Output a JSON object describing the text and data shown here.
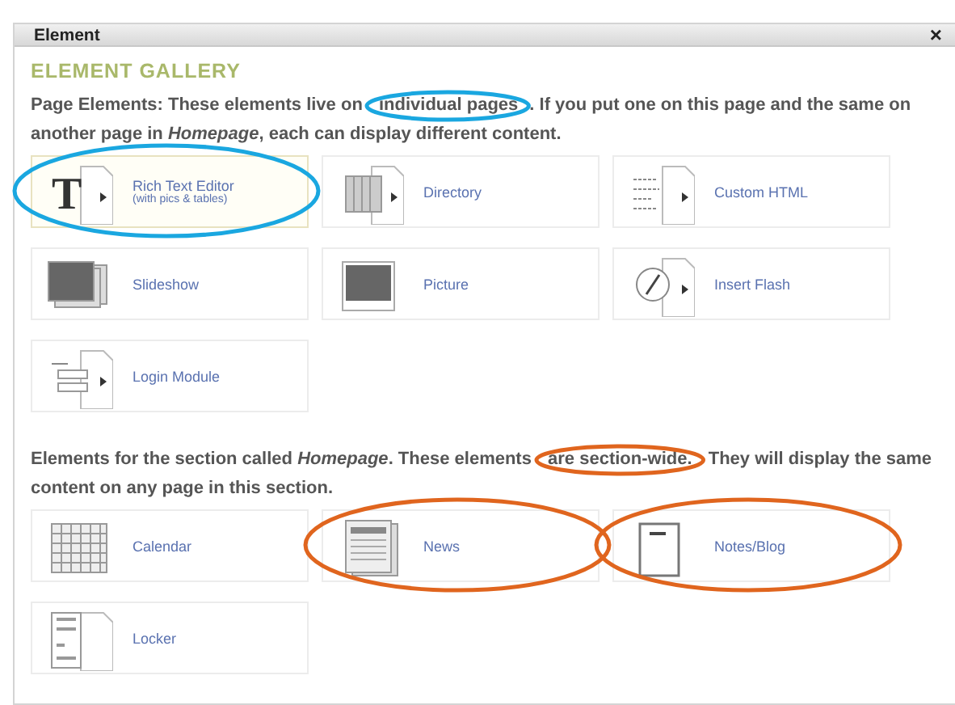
{
  "window": {
    "title": "Element",
    "close": "×"
  },
  "heading": "ELEMENT GALLERY",
  "sections": [
    {
      "intro": [
        {
          "text": "Page Elements: These elements live on "
        },
        {
          "text": "individual pages",
          "color": "#1aa7e0"
        },
        {
          "text": ". If you put one on this page and the same on another page in *Homepage*, each can display different content."
        }
      ],
      "tiles": [
        {
          "kind": "text",
          "glyph": "T",
          "label": "Rich Text Editor",
          "sublabel": "(with pics & tables)",
          "selected": true,
          "color": "#1aa7e0"
        },
        {
          "kind": "directory",
          "label": "Directory",
          "selected": false
        },
        {
          "kind": "html",
          "label": "Custom HTML",
          "selected": false
        },
        {
          "kind": "slideshow",
          "label": "Slideshow",
          "selected": false
        },
        {
          "kind": "picture",
          "label": "Picture",
          "selected": false
        },
        {
          "kind": "flash",
          "label": "Insert Flash",
          "selected": false
        },
        {
          "kind": "login",
          "label": "Login Module",
          "selected": false
        }
      ]
    },
    {
      "intro": [
        {
          "text": "Elements for the section called *Homepage*. These elements "
        },
        {
          "text": "are section-wide.",
          "color": "#e0651e"
        },
        {
          "text": " They will display the same content on any page in this section."
        }
      ],
      "tiles": [
        {
          "kind": "calendar",
          "label": "Calendar",
          "selected": false
        },
        {
          "kind": "news",
          "label": "News",
          "selected": false,
          "color": "#e0651e"
        },
        {
          "kind": "notes",
          "label": "Notes/Blog",
          "selected": false,
          "color": "#e0651e"
        },
        {
          "kind": "locker",
          "label": "Locker",
          "selected": false
        }
      ]
    }
  ]
}
